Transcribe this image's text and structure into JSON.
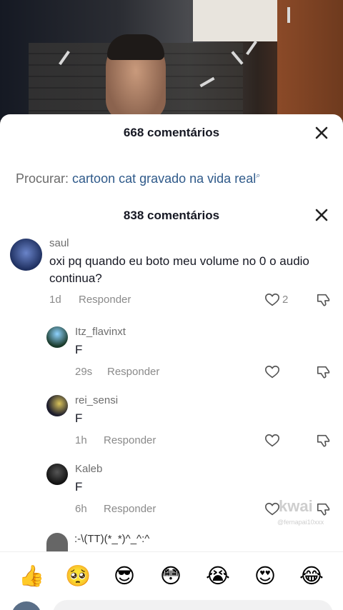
{
  "sheet": {
    "title_top": "668 comentários",
    "search_label": "Procurar:",
    "search_query": "cartoon cat gravado na vida real",
    "title_main": "838 comentários"
  },
  "comments": [
    {
      "user": "saul",
      "text": "oxi pq quando eu boto meu volume no 0 o audio continua?",
      "time": "1d",
      "reply": "Responder",
      "likes": "2"
    },
    {
      "user": "Itz_flavinxt",
      "text": "F",
      "time": "29s",
      "reply": "Responder"
    },
    {
      "user": "rei_sensi",
      "text": "F",
      "time": "1h",
      "reply": "Responder"
    },
    {
      "user": "Kaleb",
      "text": "F",
      "time": "6h",
      "reply": "Responder"
    }
  ],
  "partial_comment": ":-\\(TT)(*_*)^_^:^",
  "watermark": {
    "brand": "kwai",
    "handle": "@fernapai10xxx"
  },
  "emojis": [
    "👍",
    "🥺",
    "😎",
    "😳",
    "😭",
    "😍",
    "😂"
  ],
  "colors": {
    "link": "#2f5a8a",
    "sheet_bg": "#ffffff",
    "muted": "#8a8a8a"
  }
}
